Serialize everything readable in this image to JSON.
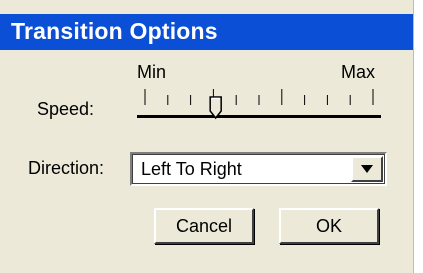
{
  "dialog": {
    "title": "Transition Options"
  },
  "speed": {
    "label": "Speed:",
    "min_label": "Min",
    "max_label": "Max",
    "value_fraction": 0.31,
    "tick_count": 11
  },
  "direction": {
    "label": "Direction:",
    "selected": "Left To Right",
    "dropdown_icon": "triangle-down-icon"
  },
  "buttons": {
    "cancel_label": "Cancel",
    "ok_label": "OK"
  },
  "colors": {
    "title_bar": "#0a4fd6",
    "dialog_bg": "#ece9d8"
  }
}
